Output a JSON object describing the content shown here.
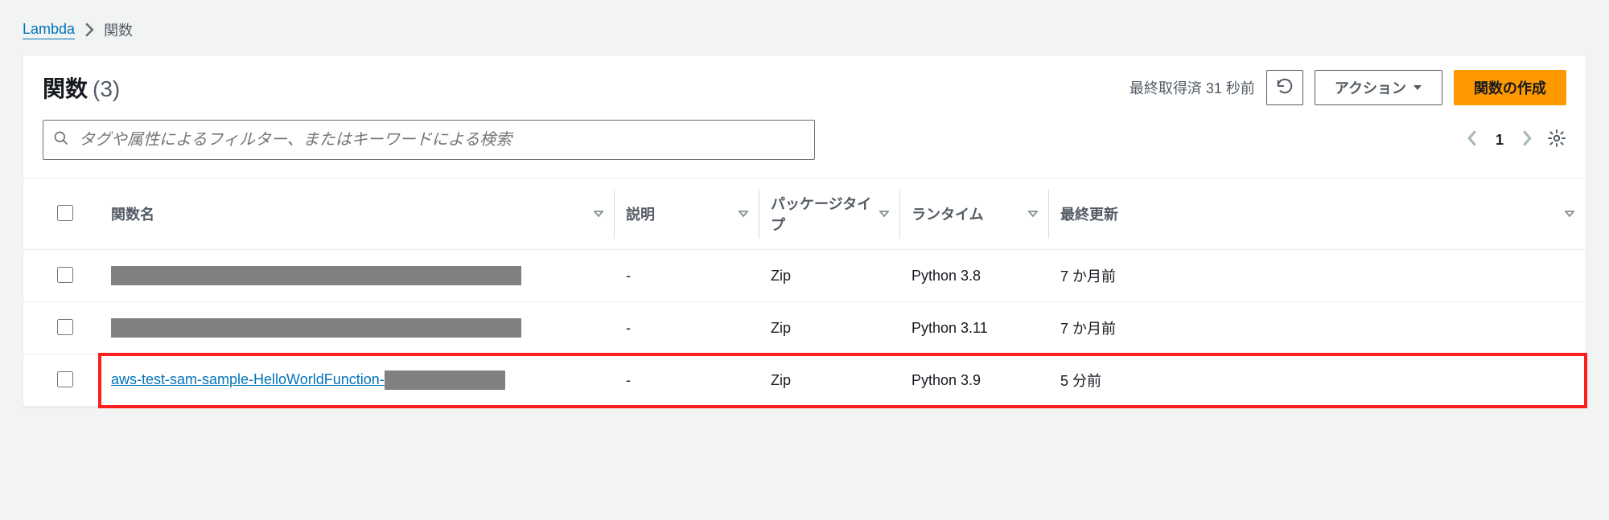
{
  "breadcrumbs": {
    "service": "Lambda",
    "current": "関数"
  },
  "header": {
    "title": "関数",
    "count_display": "(3)",
    "last_fetch": "最終取得済 31 秒前",
    "actions_label": "アクション",
    "create_label": "関数の作成"
  },
  "search": {
    "placeholder": "タグや属性によるフィルター、またはキーワードによる検索"
  },
  "pagination": {
    "page": "1"
  },
  "columns": {
    "name": "関数名",
    "description": "説明",
    "package_type": "パッケージタイプ",
    "runtime": "ランタイム",
    "last_modified": "最終更新"
  },
  "rows": [
    {
      "name_redacted": true,
      "name": "",
      "description": "-",
      "package_type": "Zip",
      "runtime": "Python 3.8",
      "last_modified": "7 か月前",
      "highlight": false
    },
    {
      "name_redacted": true,
      "name": "",
      "description": "-",
      "package_type": "Zip",
      "runtime": "Python 3.11",
      "last_modified": "7 か月前",
      "highlight": false
    },
    {
      "name_redacted": false,
      "name": "aws-test-sam-sample-HelloWorldFunction-",
      "name_trailing_redacted": true,
      "description": "-",
      "package_type": "Zip",
      "runtime": "Python 3.9",
      "last_modified": "5 分前",
      "highlight": true
    }
  ]
}
